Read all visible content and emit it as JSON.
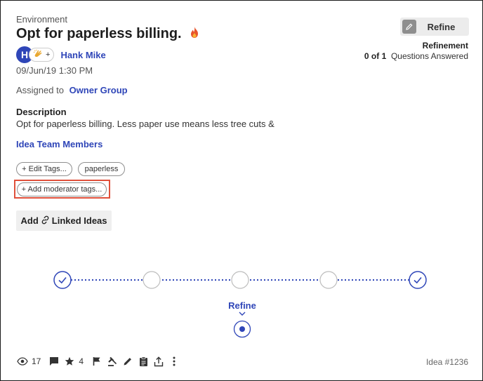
{
  "idea": {
    "category": "Environment",
    "title": "Opt for paperless billing.",
    "author": "Hank Mike",
    "avatar_initial": "H",
    "reaction_plus": "+",
    "date": "09/Jun/19 1:30 PM",
    "assigned_label": "Assigned to",
    "assigned_group": "Owner Group",
    "description_heading": "Description",
    "description_text": "Opt for paperless billing. Less paper use means less tree cuts &",
    "team_link": "Idea Team Members"
  },
  "refine": {
    "button_label": "Refine",
    "section_title": "Refinement",
    "answered_count": "0 of 1",
    "answered_label": "Questions Answered"
  },
  "tags": {
    "edit_label": "+ Edit Tags...",
    "items": [
      "paperless"
    ],
    "moderator_label": "+ Add moderator tags..."
  },
  "linked_ideas": {
    "prefix": "Add",
    "label": "Linked Ideas"
  },
  "stages": {
    "current_label": "Refine",
    "nodes": [
      "complete",
      "pending",
      "pending",
      "pending",
      "complete"
    ]
  },
  "footer": {
    "views": "17",
    "stars": "4",
    "idea_id": "Idea #1236"
  },
  "colors": {
    "accent": "#2f46b8",
    "highlight": "#e0503b",
    "fire": "#e8542b"
  }
}
